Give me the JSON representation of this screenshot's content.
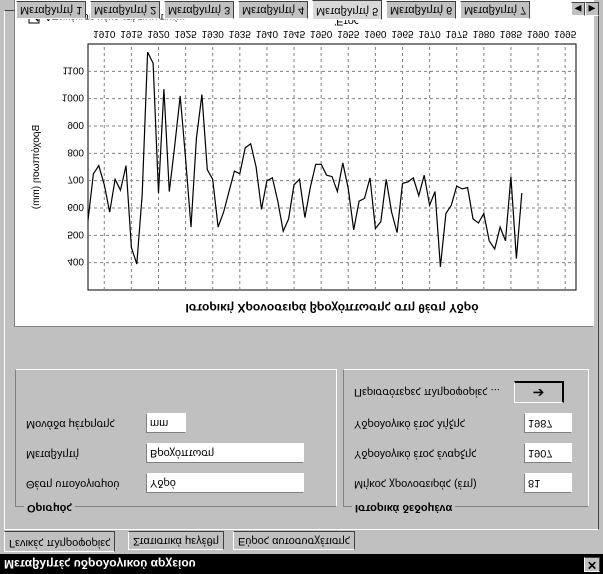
{
  "window": {
    "title": "Μεταβλητές υδρολογικού αρχείου",
    "close_glyph": "✕"
  },
  "bottom_tabs": [
    {
      "label": "Γενικές πληροφορίες",
      "active": true
    },
    {
      "label": "Στατιστικά μεγέθη",
      "active": false
    },
    {
      "label": "Εύρος αυτοσυσχέτισης",
      "active": false
    }
  ],
  "group_general": {
    "title": "Ορισμός",
    "fields": [
      {
        "label": "Θέση υπολογισμού",
        "value": "Υδρό"
      },
      {
        "label": "Μεταβλητή",
        "value": "Βροχόπτωση"
      },
      {
        "label": "Μονάδα μέτρησης",
        "value": "mm"
      }
    ]
  },
  "group_history": {
    "title": "Ιστορικά δεδομένα",
    "fields": [
      {
        "label": "Μήκος χρονοσειράς (έτη)",
        "value": "81"
      },
      {
        "label": "Υδρολογικό έτος έναρξης",
        "value": "1907"
      },
      {
        "label": "Υδρολογικό έτος λήξης",
        "value": "1987"
      }
    ],
    "more_label": "Περισσότερες πληροφορίες ...",
    "more_icon": "arrow-right-icon"
  },
  "top_tabs": [
    {
      "label": "Μεταβλητή 1",
      "active": false
    },
    {
      "label": "Μεταβλητή 2",
      "active": false
    },
    {
      "label": "Μεταβλητή 3",
      "active": false
    },
    {
      "label": "Μεταβλητή 4",
      "active": false
    },
    {
      "label": "Μεταβλητή 5",
      "active": true
    },
    {
      "label": "Μεταβλητή 6",
      "active": false
    },
    {
      "label": "Μεταβλητή 7",
      "active": false
    }
  ],
  "chart_panel": {
    "checkbox_label": "Απεικόνιση μόνο ετήσιων τιμών",
    "checkbox_checked": true
  },
  "chart_data": {
    "type": "line",
    "title": "Ιστορική Χρονοσειρά βροχόπτωσης στη θέση Υδρό",
    "xlabel": "Έτος",
    "ylabel": "Βροχόπτωση (mm)",
    "xlim": [
      1907,
      1997
    ],
    "ylim": [
      300,
      1200
    ],
    "y_inverted": true,
    "grid": true,
    "x_ticks": [
      1910,
      1915,
      1920,
      1925,
      1930,
      1935,
      1940,
      1945,
      1950,
      1955,
      1960,
      1965,
      1970,
      1975,
      1980,
      1985,
      1990,
      1995
    ],
    "y_ticks": [
      400,
      500,
      600,
      700,
      800,
      900,
      1000,
      1100
    ],
    "x": [
      1907,
      1908,
      1909,
      1910,
      1911,
      1912,
      1913,
      1914,
      1915,
      1916,
      1917,
      1918,
      1919,
      1920,
      1921,
      1922,
      1923,
      1924,
      1925,
      1926,
      1927,
      1928,
      1929,
      1930,
      1931,
      1932,
      1933,
      1934,
      1935,
      1936,
      1937,
      1938,
      1939,
      1940,
      1941,
      1942,
      1943,
      1944,
      1945,
      1946,
      1947,
      1948,
      1949,
      1950,
      1951,
      1952,
      1953,
      1954,
      1955,
      1956,
      1957,
      1958,
      1959,
      1960,
      1961,
      1962,
      1963,
      1964,
      1965,
      1966,
      1967,
      1968,
      1969,
      1970,
      1971,
      1972,
      1973,
      1974,
      1975,
      1976,
      1977,
      1978,
      1979,
      1980,
      1981,
      1982,
      1983,
      1984,
      1985,
      1986,
      1987
    ],
    "values": [
      555,
      725,
      755,
      685,
      585,
      705,
      665,
      755,
      455,
      395,
      650,
      1170,
      1130,
      655,
      1035,
      660,
      830,
      1010,
      780,
      530,
      855,
      1015,
      740,
      705,
      530,
      585,
      660,
      735,
      725,
      820,
      835,
      750,
      595,
      700,
      710,
      625,
      515,
      560,
      685,
      705,
      565,
      675,
      760,
      760,
      720,
      715,
      660,
      765,
      670,
      520,
      625,
      635,
      710,
      525,
      550,
      705,
      585,
      510,
      690,
      695,
      710,
      645,
      720,
      610,
      660,
      385,
      580,
      610,
      680,
      670,
      675,
      560,
      545,
      580,
      480,
      450,
      530,
      480,
      715,
      415,
      655
    ]
  }
}
